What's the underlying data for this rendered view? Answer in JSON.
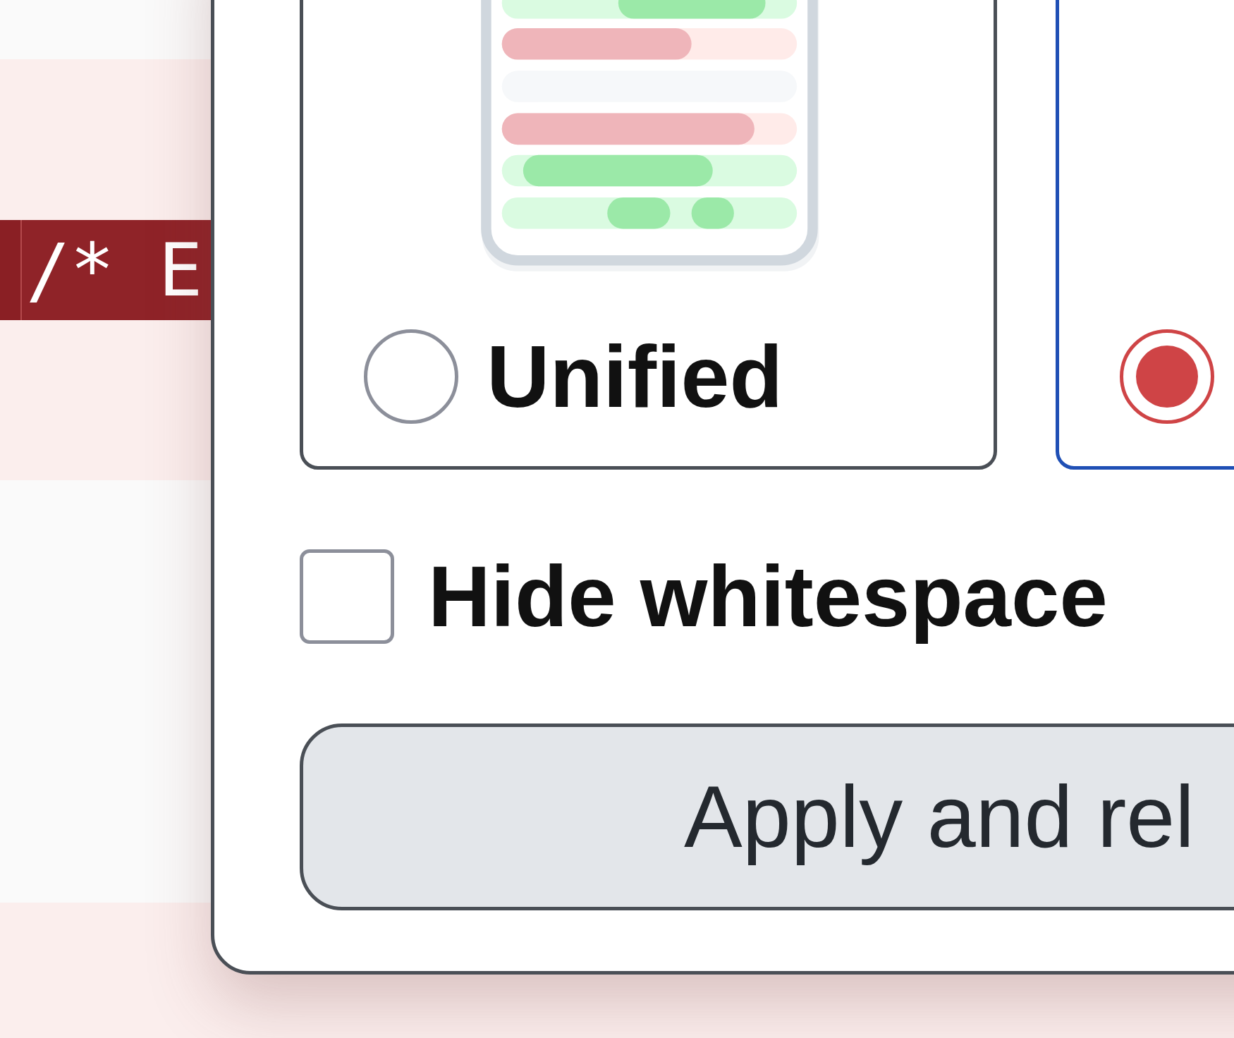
{
  "code_lines": [
    {
      "kind": "plain"
    },
    {
      "kind": "deleted"
    },
    {
      "kind": "highlighted",
      "text": "/* E"
    },
    {
      "kind": "deleted"
    },
    {
      "kind": "plain"
    },
    {
      "kind": "deleted"
    }
  ],
  "view_options": [
    {
      "kind": "unified",
      "label": "Unified",
      "selected": false
    },
    {
      "kind": "split",
      "selected": true
    }
  ],
  "hide_whitespace": {
    "label": "Hide whitespace",
    "checked": false
  },
  "apply_button": {
    "label": "Apply and rel"
  }
}
